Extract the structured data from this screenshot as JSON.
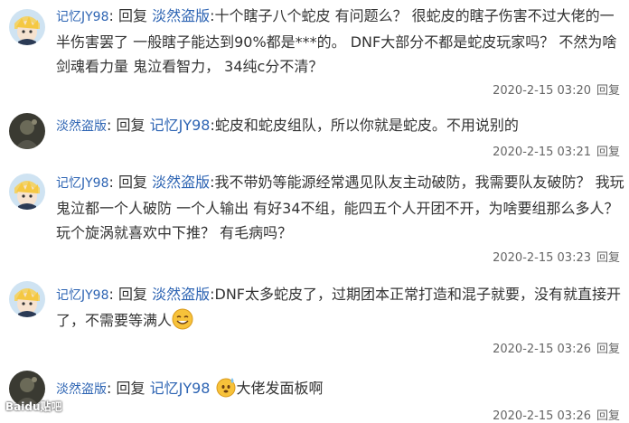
{
  "replies": [
    {
      "user": "记忆JY98",
      "reply_word": "回复",
      "target": "淡然盗版",
      "text": ":十个瞎子八个蛇皮 有问题么？ 很蛇皮的瞎子伤害不过大佬的一半伤害罢了 一般瞎子能达到90%都是***的。 DNF大部分不都是蛇皮玩家吗？ 不然为啥剑魂看力量 鬼泣看智力， 34纯c分不清？",
      "time": "2020-2-15 03:20",
      "reply_btn": "回复",
      "avatar": "anime-avatar"
    },
    {
      "user": "淡然盗版",
      "reply_word": "回复",
      "target": "记忆JY98",
      "text": ":蛇皮和蛇皮组队，所以你就是蛇皮。不用说别的",
      "time": "2020-2-15 03:21",
      "reply_btn": "回复",
      "avatar": "dark-avatar"
    },
    {
      "user": "记忆JY98",
      "reply_word": "回复",
      "target": "淡然盗版",
      "text": ":我不带奶等能源经常遇见队友主动破防，我需要队友破防？ 我玩鬼泣都一个人破防 一个人输出 有好34不组，能四五个人开团不开，为啥要组那么多人？ 玩个旋涡就喜欢中下推？ 有毛病吗？",
      "time": "2020-2-15 03:23",
      "reply_btn": "回复",
      "avatar": "anime-avatar"
    },
    {
      "user": "记忆JY98",
      "reply_word": "回复",
      "target": "淡然盗版",
      "text": ":DNF太多蛇皮了，过期团本正常打造和混子就要，没有就直接开了，不需要等满人",
      "time": "2020-2-15 03:26",
      "reply_btn": "回复",
      "avatar": "anime-avatar",
      "emoji": "smile-emoji"
    },
    {
      "user": "淡然盗版",
      "reply_word": "回复",
      "target": "记忆JY98",
      "text": "大佬发面板啊",
      "time": "2020-2-15 03:26",
      "reply_btn": "回复",
      "avatar": "dark-avatar",
      "emoji": "sweat-emoji"
    }
  ],
  "watermark": "Baidu贴吧"
}
